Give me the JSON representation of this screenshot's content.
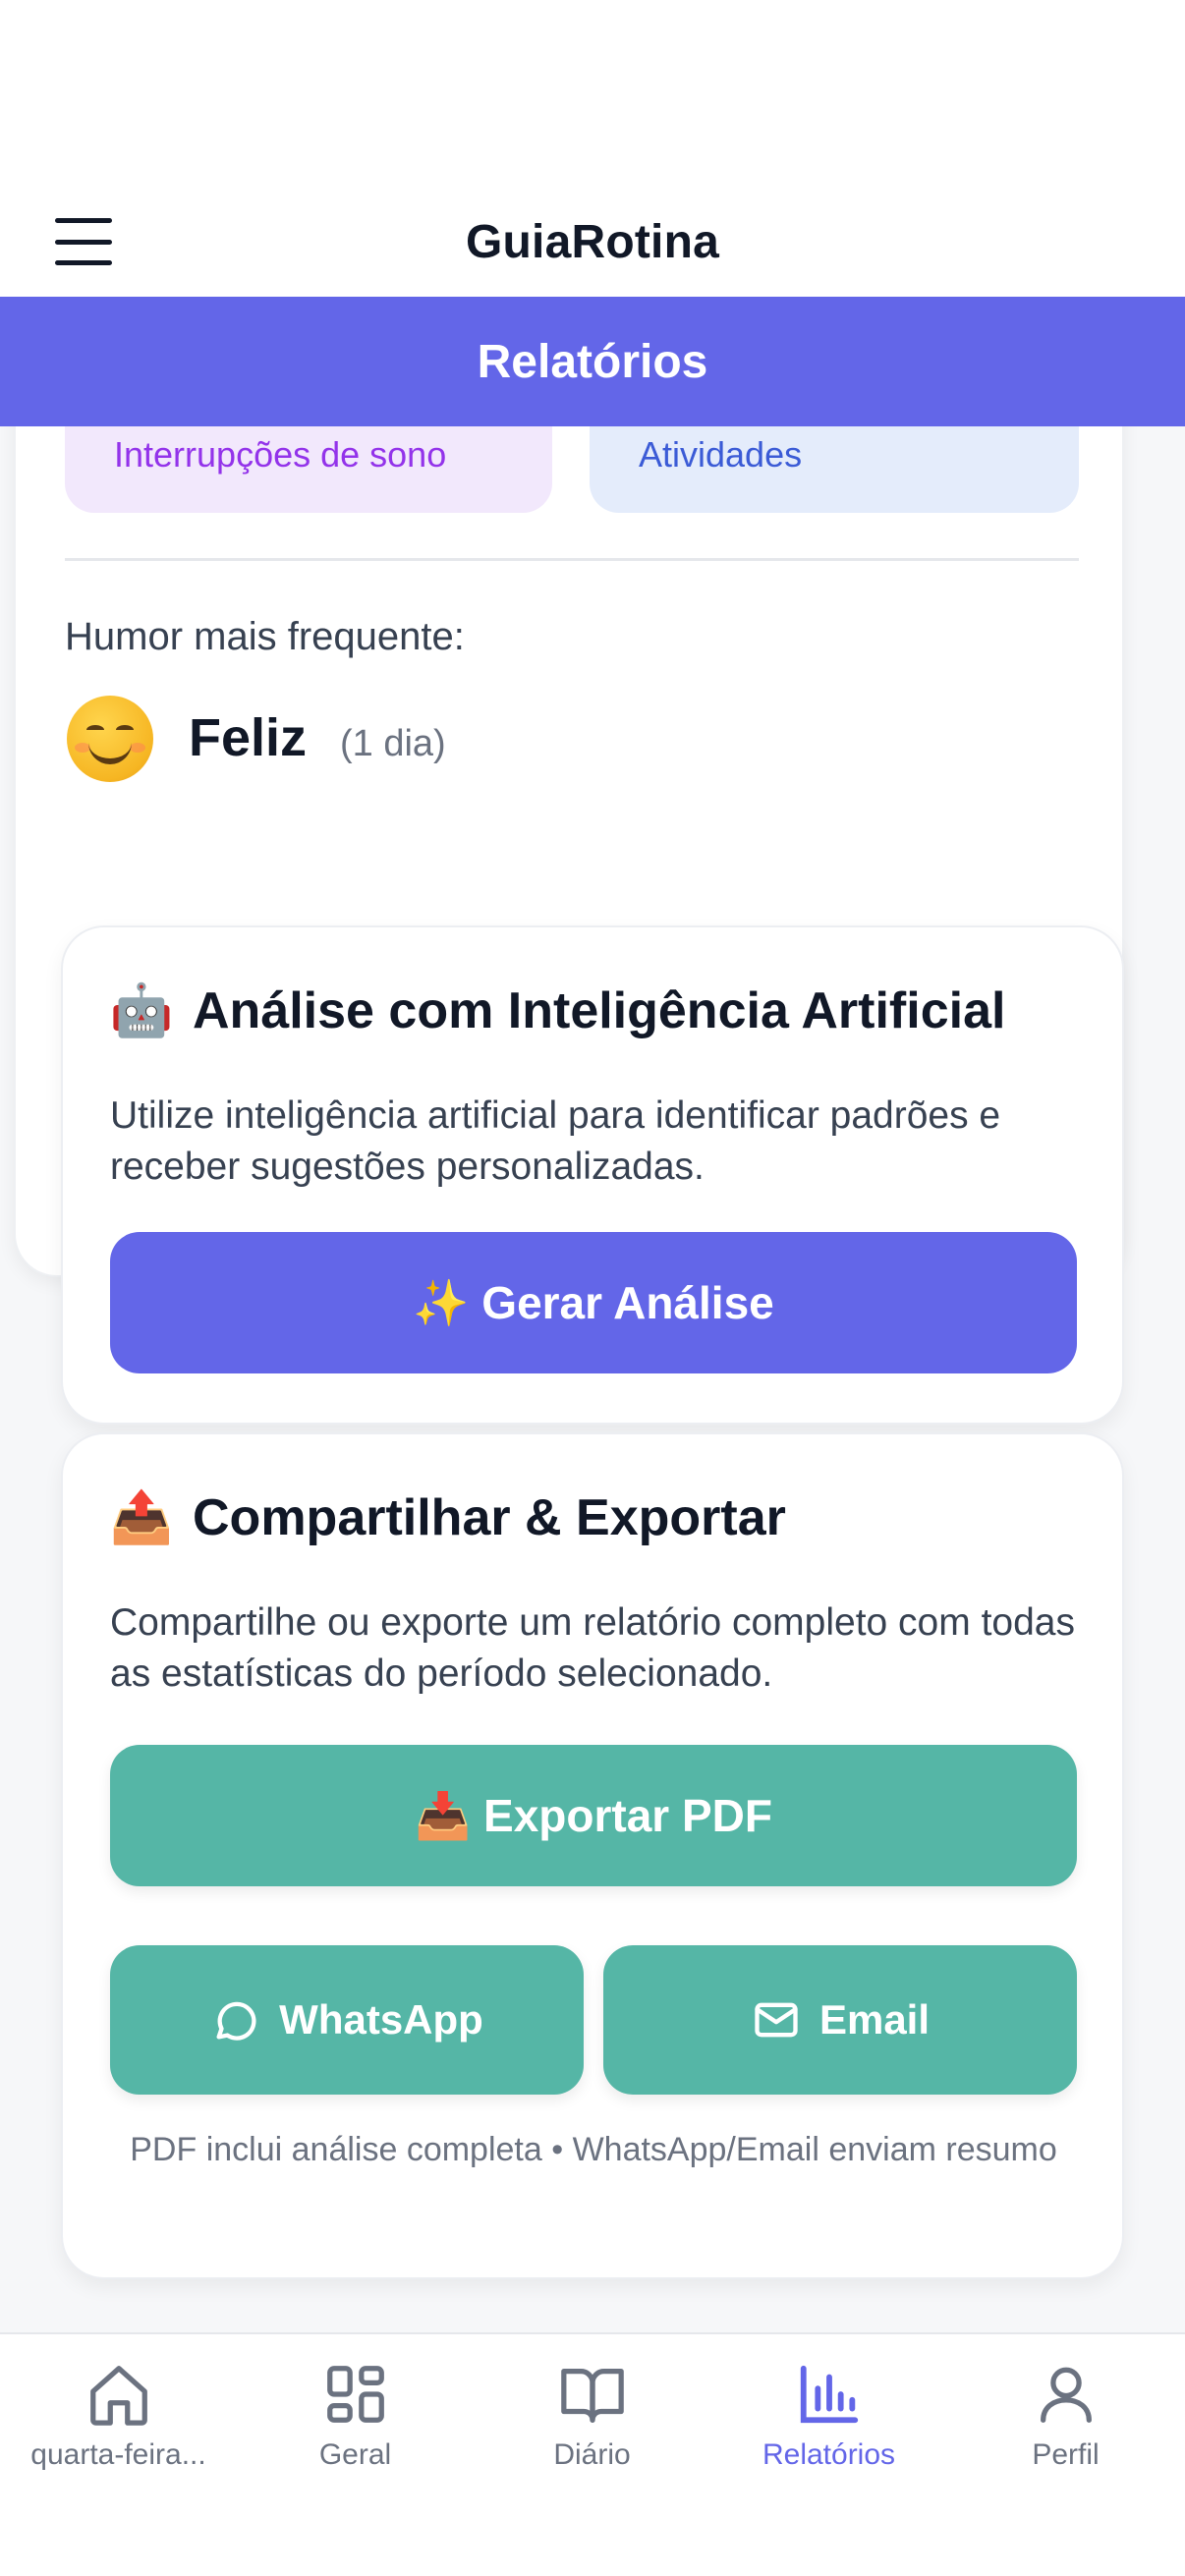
{
  "header": {
    "title": "GuiaRotina",
    "section": "Relatórios"
  },
  "summary": {
    "tiles": [
      {
        "label": "Interrupções de sono"
      },
      {
        "label": "Atividades"
      }
    ],
    "mood_caption": "Humor mais frequente:",
    "mood_name": "Feliz",
    "mood_days": "(1 dia)"
  },
  "ai": {
    "icon": "🤖",
    "title": "Análise com Inteligência Artificial",
    "description": "Utilize inteligência artificial para identificar padrões e receber sugestões personalizadas.",
    "button_label": "✨ Gerar Análise"
  },
  "share": {
    "icon": "📤",
    "title": "Compartilhar & Exportar",
    "description": "Compartilhe ou exporte um relatório completo com todas as estatísticas do período selecionado.",
    "pdf_label": "📥 Exportar PDF",
    "whatsapp_label": "WhatsApp",
    "email_label": "Email",
    "note": "PDF inclui análise completa • WhatsApp/Email enviam resumo"
  },
  "nav": {
    "items": [
      {
        "label": "quarta-feira...",
        "icon": "home-icon"
      },
      {
        "label": "Geral",
        "icon": "grid-icon"
      },
      {
        "label": "Diário",
        "icon": "book-icon"
      },
      {
        "label": "Relatórios",
        "icon": "bar-chart-icon"
      },
      {
        "label": "Perfil",
        "icon": "user-icon"
      }
    ],
    "active": "Relatórios"
  },
  "colors": {
    "accent": "#6366e8",
    "teal": "#55b6a6",
    "sleep_tile": "#f2e8fc",
    "activities_tile": "#e4ecfb"
  }
}
